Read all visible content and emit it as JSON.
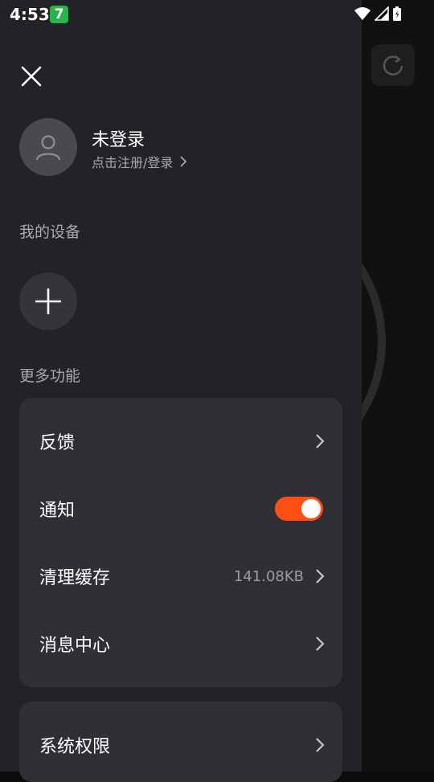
{
  "status_bar": {
    "time": "4:53",
    "notification_badge": "7"
  },
  "profile": {
    "name": "未登录",
    "login_prompt": "点击注册/登录"
  },
  "sections": {
    "devices_title": "我的设备",
    "more_title": "更多功能"
  },
  "menu_main": [
    {
      "label": "反馈"
    },
    {
      "label": "通知",
      "toggle_on": true
    },
    {
      "label": "清理缓存",
      "value": "141.08KB"
    },
    {
      "label": "消息中心"
    }
  ],
  "menu_second": [
    {
      "label": "系统权限"
    }
  ],
  "colors": {
    "accent": "#ff4f14",
    "drawer_bg": "#232226",
    "card_bg": "#302f35"
  }
}
